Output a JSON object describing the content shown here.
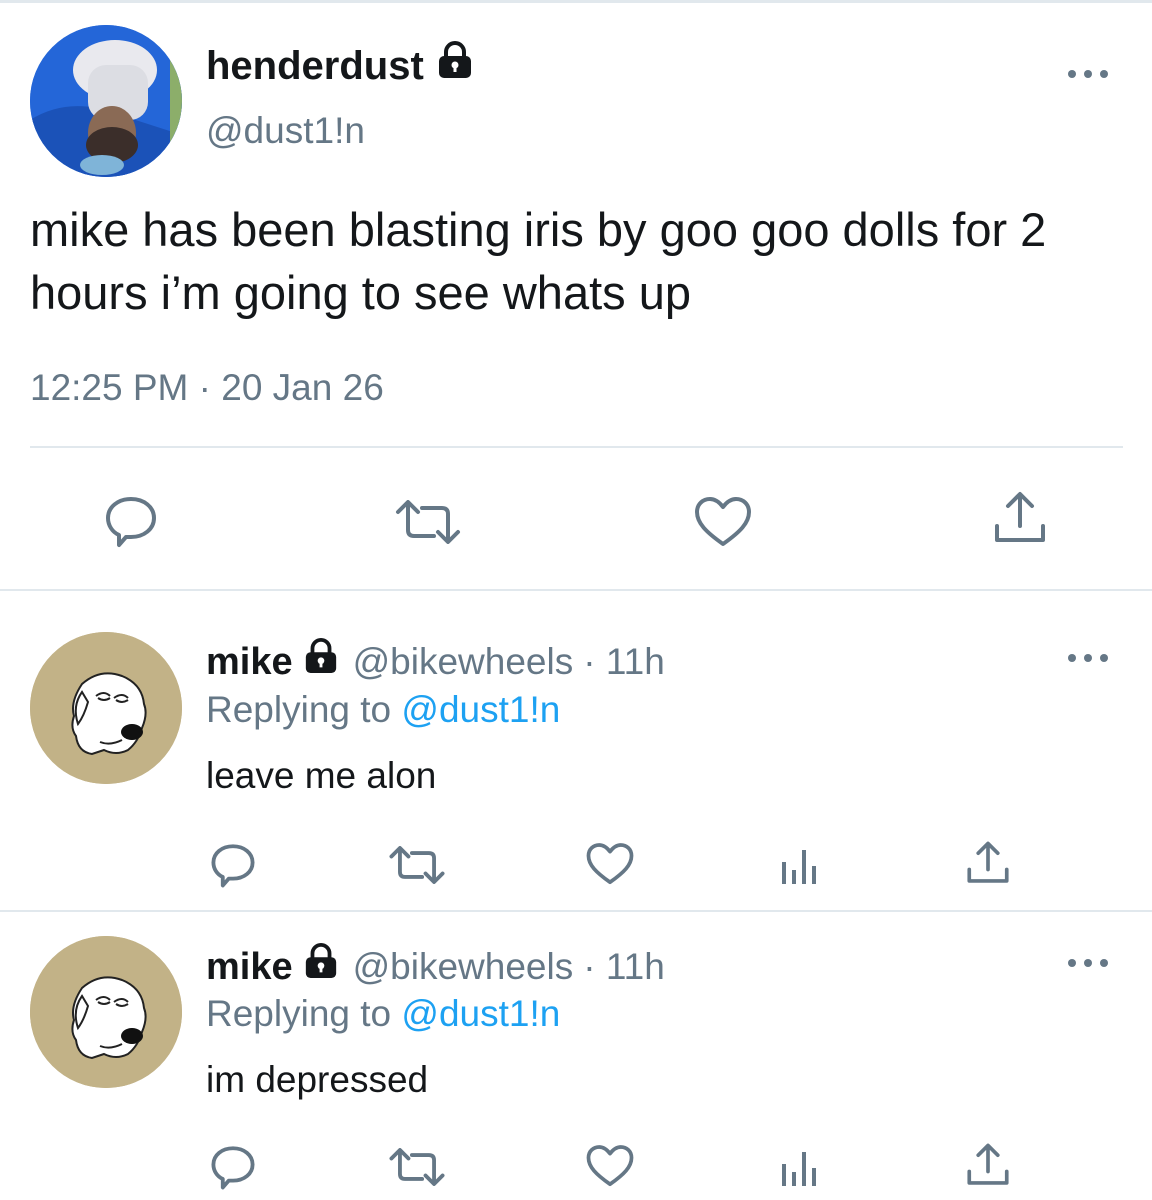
{
  "main_tweet": {
    "display_name": "henderdust",
    "handle": "@dust1!n",
    "text": "mike has been blasting iris by goo goo dolls for 2 hours i’m going to see whats up",
    "time": "12:25 PM · 20 Jan 26",
    "protected": true
  },
  "replies": [
    {
      "display_name": "mike",
      "handle": "@bikewheels",
      "age": "· 11h",
      "replying_prefix": "Replying to",
      "replying_to": "@dust1!n",
      "text": "leave me alon",
      "protected": true
    },
    {
      "display_name": "mike",
      "handle": "@bikewheels",
      "age": "· 11h",
      "replying_prefix": "Replying to",
      "replying_to": "@dust1!n",
      "text": "im depressed",
      "protected": true
    }
  ],
  "icons": {
    "reply": "speech-bubble-icon",
    "retweet": "retweet-icon",
    "like": "heart-icon",
    "share": "share-icon",
    "analytics": "analytics-icon",
    "more": "more-dots-icon",
    "lock": "lock-icon"
  },
  "colors": {
    "text": "#14171a",
    "secondary": "#657786",
    "link": "#1da1f2",
    "divider": "#e1e8ed",
    "reply_avatar_bg": "#c2b287"
  }
}
